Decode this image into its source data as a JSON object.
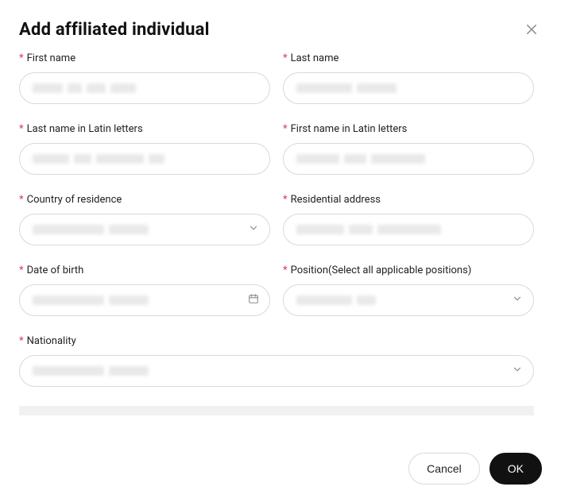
{
  "modal": {
    "title": "Add affiliated individual",
    "labels": {
      "first_name": "First name",
      "last_name": "Last name",
      "last_name_latin": "Last name in Latin letters",
      "first_name_latin": "First name in Latin letters",
      "country_of_residence": "Country of residence",
      "residential_address": "Residential address",
      "date_of_birth": "Date of birth",
      "position": "Position(Select all applicable positions)",
      "nationality": "Nationality"
    },
    "required_mark": "*",
    "footer": {
      "cancel": "Cancel",
      "ok": "OK"
    }
  }
}
